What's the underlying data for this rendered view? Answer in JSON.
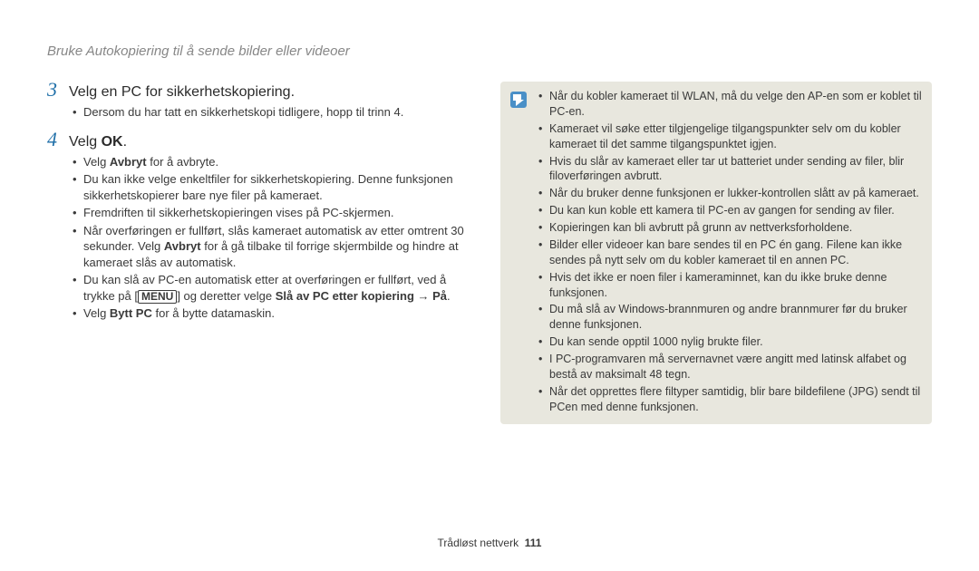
{
  "header": "Bruke Autokopiering til å sende bilder eller videoer",
  "steps": [
    {
      "num": "3",
      "title_pre": "Velg en PC for sikkerhetskopiering.",
      "title_bold": "",
      "title_post": "",
      "bullets": [
        "Dersom du har tatt en sikkerhetskopi tidligere, hopp til trinn 4."
      ]
    },
    {
      "num": "4",
      "title_pre": "Velg ",
      "title_bold": "OK",
      "title_post": ".",
      "bullets_special": true
    }
  ],
  "step4": {
    "b0_pre": "Velg ",
    "b0_bold": "Avbryt",
    "b0_post": " for å avbryte.",
    "b1": "Du kan ikke velge enkeltfiler for sikkerhetskopiering. Denne funksjonen sikkerhetskopierer bare nye filer på kameraet.",
    "b2": "Fremdriften til sikkerhetskopieringen vises på PC-skjermen.",
    "b3_pre": "Når overføringen er fullført, slås kameraet automatisk av etter omtrent 30 sekunder. Velg ",
    "b3_bold": "Avbryt",
    "b3_post": " for å gå tilbake til forrige skjermbilde og hindre at kameraet slås av automatisk.",
    "b4_pre": "Du kan slå av PC-en automatisk etter at overføringen er fullført, ved å trykke på [",
    "b4_menu": "MENU",
    "b4_mid": "] og deretter velge ",
    "b4_bold": "Slå av PC etter kopiering → På",
    "b4_post": ".",
    "b5_pre": "Velg ",
    "b5_bold": "Bytt PC",
    "b5_post": " for å bytte datamaskin."
  },
  "notes": [
    "Når du kobler kameraet til WLAN, må du velge den AP-en som er koblet til PC-en.",
    "Kameraet vil søke etter tilgjengelige tilgangspunkter selv om du kobler kameraet til det samme tilgangspunktet igjen.",
    "Hvis du slår av kameraet eller tar ut batteriet under sending av filer, blir filoverføringen avbrutt.",
    "Når du bruker denne funksjonen er lukker-kontrollen slått av på kameraet.",
    "Du kan kun koble ett kamera til PC-en av gangen for sending av filer.",
    "Kopieringen kan bli avbrutt på grunn av nettverksforholdene.",
    "Bilder eller videoer kan bare sendes til en PC én gang. Filene kan ikke sendes på nytt selv om du kobler kameraet til en annen PC.",
    "Hvis det ikke er noen filer i kameraminnet, kan du ikke bruke denne funksjonen.",
    "Du må slå av Windows-brannmuren og andre brannmurer før du bruker denne funksjonen.",
    "Du kan sende opptil 1000 nylig brukte filer.",
    "I PC-programvaren må servernavnet være angitt med latinsk alfabet og bestå av maksimalt 48 tegn.",
    "Når det opprettes flere filtyper samtidig, blir bare bildefilene (JPG) sendt til PCen med denne funksjonen."
  ],
  "footer": {
    "section": "Trådløst nettverk",
    "page": "111"
  }
}
